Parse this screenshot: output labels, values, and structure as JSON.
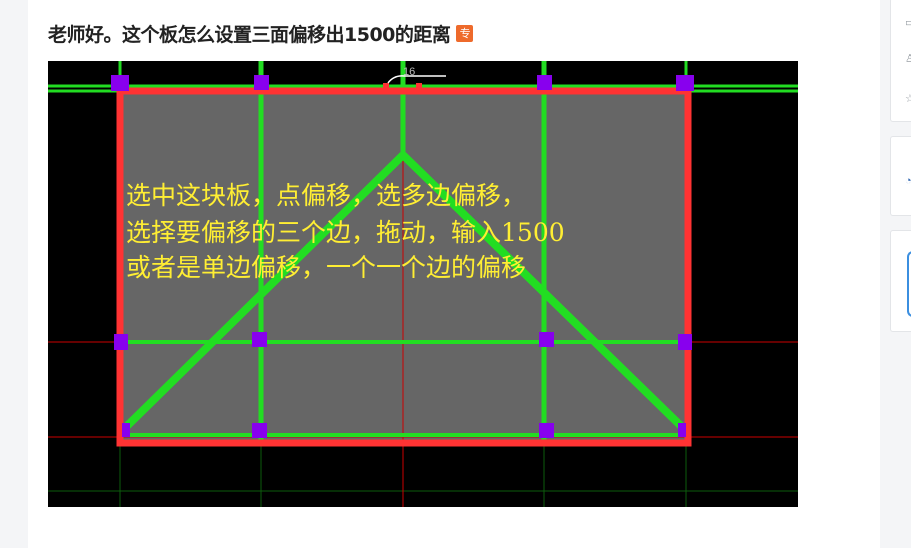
{
  "question": {
    "title": "老师好。这个板怎么设置三面偏移出1500的距离",
    "badge": "专"
  },
  "image": {
    "dimension_label": "16",
    "annotation_lines": [
      "选中这块板，点偏移，选多边偏移，",
      "选择要偏移的三个边，拖动，输入1500",
      "或者是单边偏移，一个一个边的偏移"
    ],
    "colors": {
      "background": "#000000",
      "slab_fill": "#666666",
      "beam": "#22dd22",
      "slab_outline": "#ff3333",
      "column": "#8800ee",
      "annotation_text": "#ffee33",
      "axis": "#cc0000",
      "grid": "#0d5c0d"
    }
  },
  "right_sidebar": {
    "icons": [
      "comment-icon",
      "user-icon",
      "star-icon",
      "avatar-icon",
      "input-icon"
    ]
  },
  "colors": {
    "page_bg": "#f4f5f7",
    "card_bg": "#ffffff",
    "title_text": "#222222",
    "badge_bg": "#ee6a2b"
  }
}
